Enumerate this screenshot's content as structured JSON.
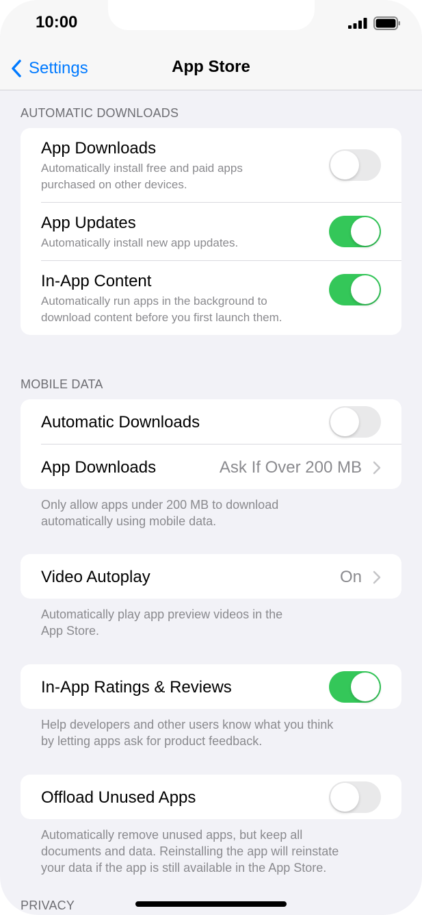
{
  "status_bar": {
    "time": "10:00"
  },
  "nav": {
    "back_label": "Settings",
    "title": "App Store"
  },
  "automatic_downloads": {
    "header": "AUTOMATIC DOWNLOADS",
    "app_downloads": {
      "title": "App Downloads",
      "sub1": "Automatically install free and paid apps",
      "sub2": "purchased on other devices.",
      "enabled": false
    },
    "app_updates": {
      "title": "App Updates",
      "sub1": "Automatically install new app updates.",
      "enabled": true
    },
    "in_app_content": {
      "title": "In-App Content",
      "sub1": "Automatically run apps in the background to",
      "sub2": "download content before you first launch them.",
      "enabled": true
    }
  },
  "mobile_data": {
    "header": "MOBILE DATA",
    "automatic_downloads": {
      "title": "Automatic Downloads",
      "enabled": false
    },
    "app_downloads": {
      "title": "App Downloads",
      "value": "Ask If Over 200 MB"
    },
    "footer1": "Only allow apps under 200 MB to download",
    "footer2": "automatically using mobile data."
  },
  "video_autoplay": {
    "title": "Video Autoplay",
    "value": "On",
    "footer1": "Automatically play app preview videos in the",
    "footer2": "App Store."
  },
  "ratings": {
    "title": "In-App Ratings & Reviews",
    "enabled": true,
    "footer1": "Help developers and other users know what you think",
    "footer2": "by letting apps ask for product feedback."
  },
  "offload": {
    "title": "Offload Unused Apps",
    "enabled": false,
    "footer1": "Automatically remove unused apps, but keep all",
    "footer2": "documents and data. Reinstalling the app will reinstate",
    "footer3": "your data if the app is still available in the App Store."
  },
  "privacy": {
    "header": "PRIVACY"
  },
  "colors": {
    "accent": "#007aff",
    "toggle_on": "#34c759",
    "toggle_off": "#e9e9ea",
    "background": "#f2f2f7"
  }
}
